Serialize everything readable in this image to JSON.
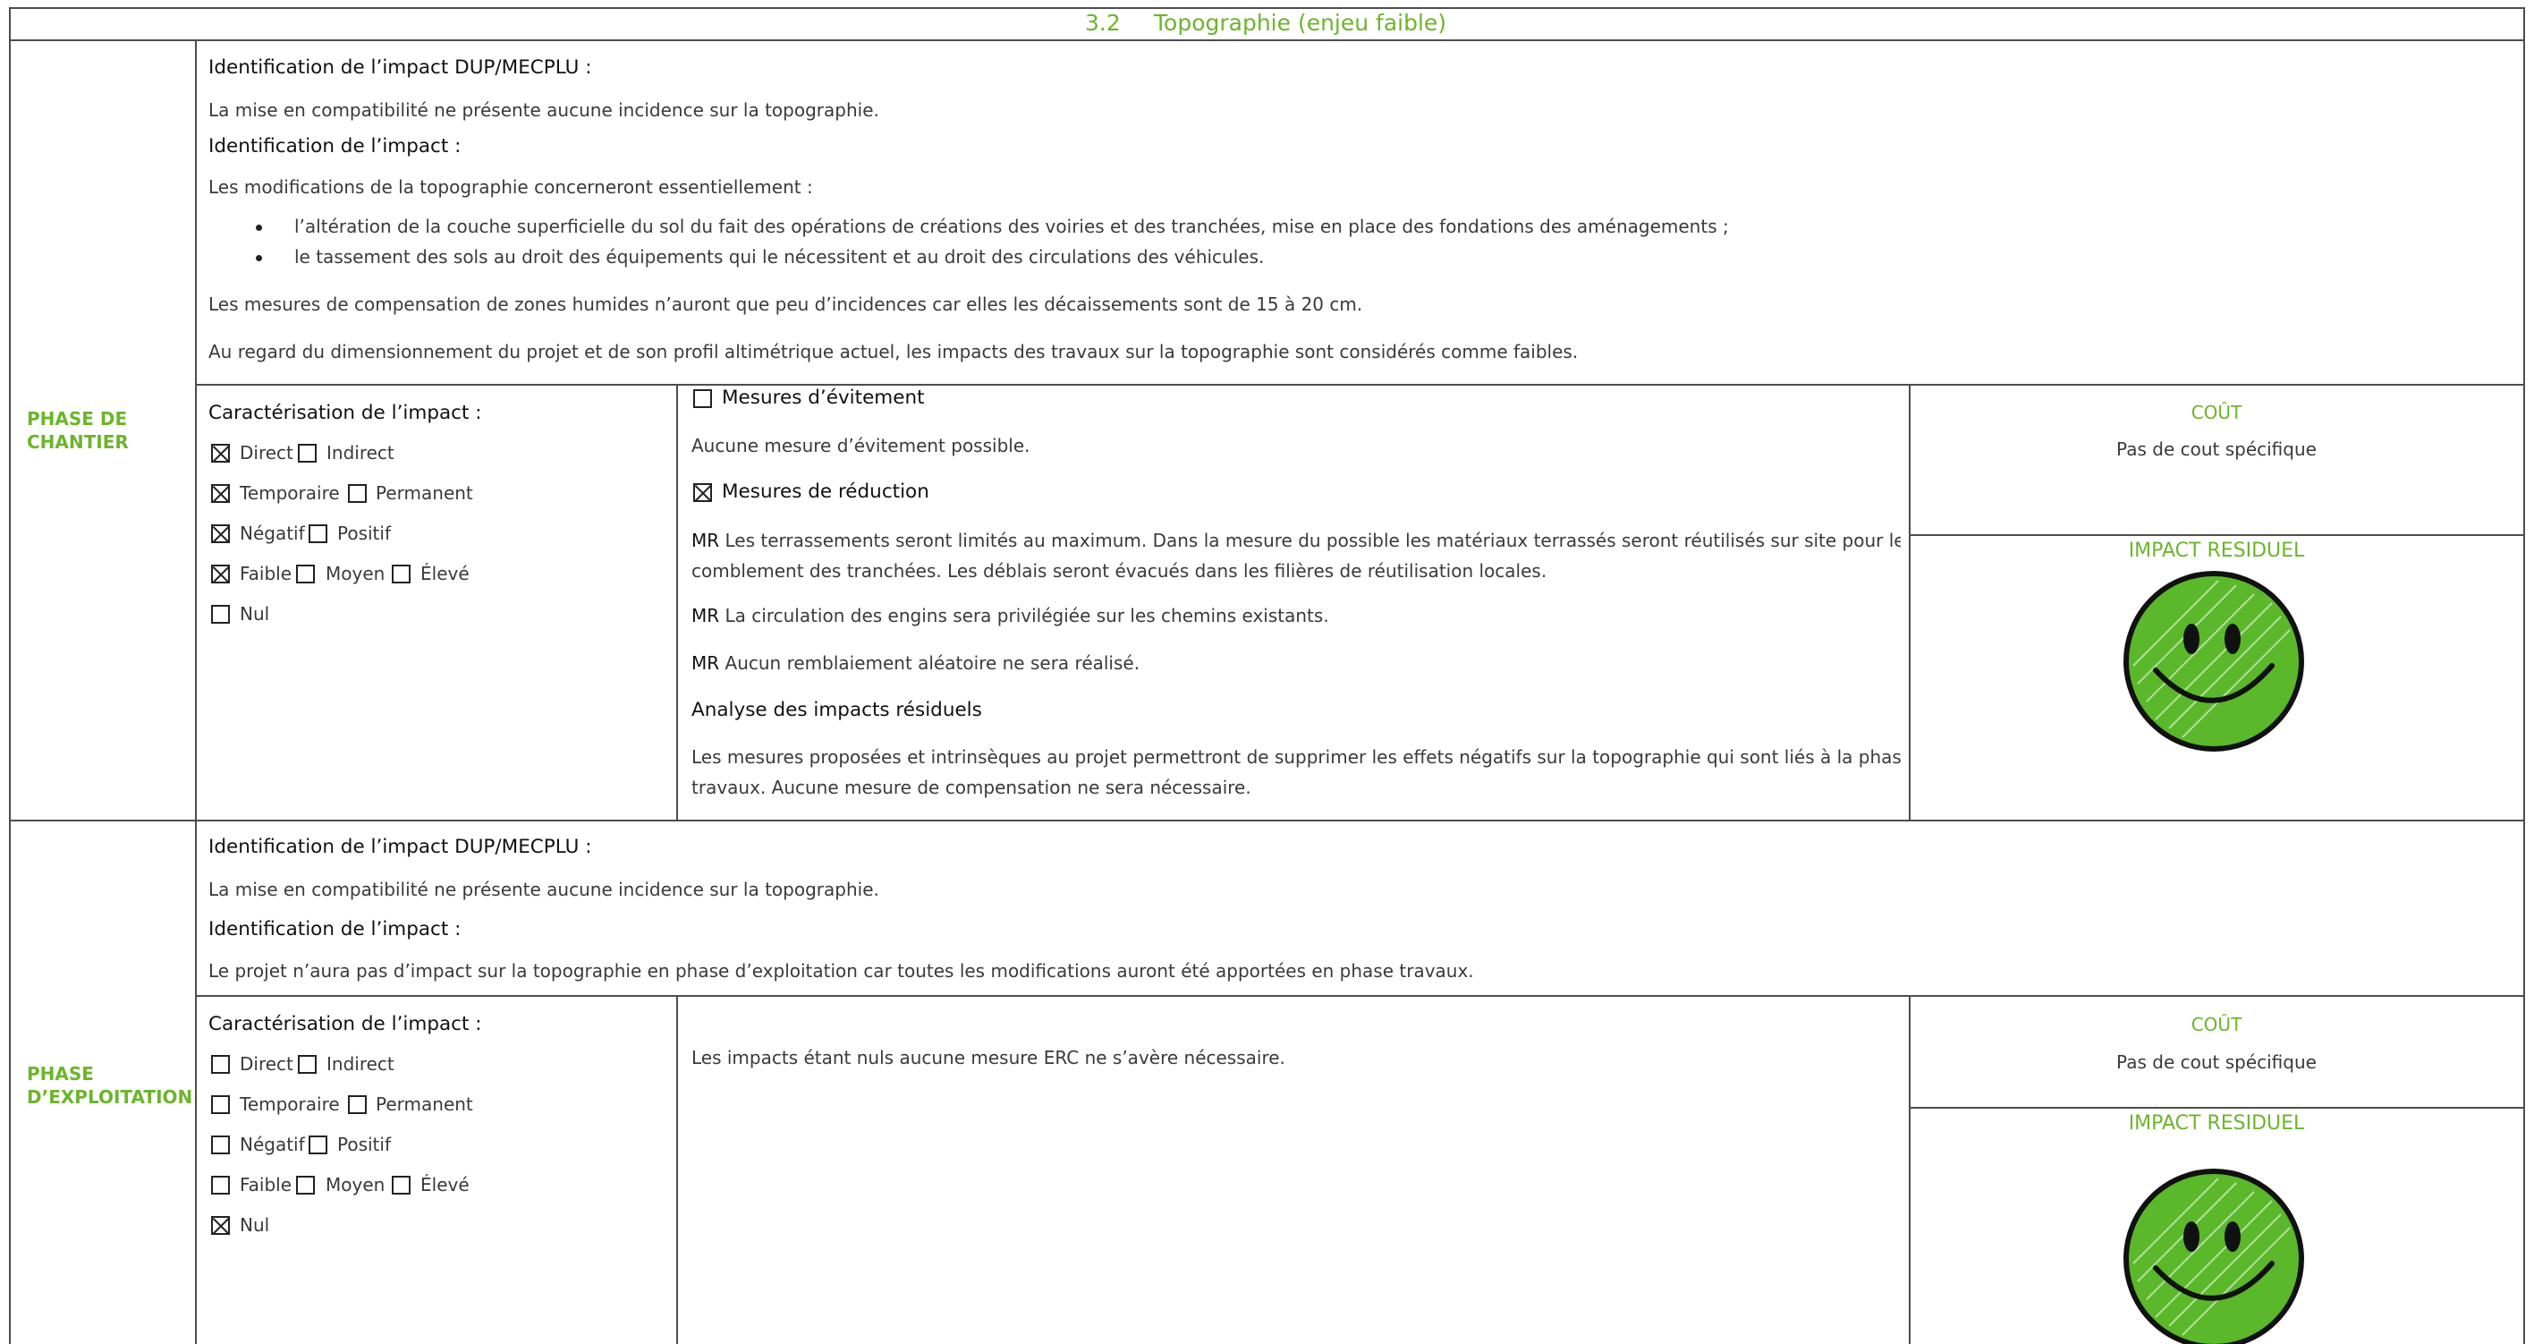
{
  "section": {
    "number": "3.2",
    "title": "Topographie (enjeu faible)"
  },
  "phase1": {
    "label_line1": "PHASE DE",
    "label_line2": "CHANTIER",
    "id_dup_heading": "Identification de l’impact DUP/MECPLU :",
    "id_dup_text": "La mise en compatibilité ne présente aucune incidence sur la topographie.",
    "id_heading": "Identification de l’impact :",
    "intro": "Les modifications de la topographie concerneront essentiellement :",
    "bullet1": "l’altération de la couche superficielle du sol du fait des opérations de créations des voiries et des tranchées, mise en place des fondations des aménagements ;",
    "bullet2": "le tassement des sols au droit des équipements qui le nécessitent et au droit des circulations des véhicules.",
    "para1": "Les mesures de compensation de zones humides n’auront que peu d’incidences car elles les décaissements sont de 15 à 20 cm.",
    "para2": "Au regard du dimensionnement du projet et de son profil altimétrique actuel, les impacts des travaux sur la topographie sont considérés comme faibles.",
    "carac_heading": "Caractérisation de l’impact :",
    "carac": {
      "direct": "Direct",
      "indirect": "Indirect",
      "temporaire": "Temporaire",
      "permanent": "Permanent",
      "negatif": "Négatif",
      "positif": "Positif",
      "faible": "Faible",
      "moyen": "Moyen",
      "eleve": "Élevé",
      "nul": "Nul"
    },
    "evitement_heading": "Mesures d’évitement",
    "evitement_text": "Aucune mesure d’évitement possible.",
    "reduction_heading": "Mesures de réduction",
    "mr_tag": "MR",
    "mr1_line1": "Les terrassements seront limités au maximum. Dans la mesure du possible les matériaux terrassés seront réutilisés sur site pour le",
    "mr1_line2": "comblement des tranchées. Les déblais seront évacués dans les filières de réutilisation locales.",
    "mr2": "La circulation des engins sera privilégiée sur les chemins existants.",
    "mr3": "Aucun remblaiement aléatoire ne sera réalisé.",
    "analyse_heading": "Analyse des impacts résiduels",
    "analyse_line1": "Les mesures proposées et intrinsèques au projet permettront de supprimer les effets négatifs sur la topographie qui sont liés à la phase",
    "analyse_line2": "travaux. Aucune mesure de compensation ne sera nécessaire.",
    "cout_heading": "COÛT",
    "cout_text": "Pas de cout spécifique",
    "residuel_heading": "IMPACT RESIDUEL"
  },
  "phase2": {
    "label_line1": "PHASE",
    "label_line2": "D’EXPLOITATION",
    "id_dup_heading": "Identification de l’impact DUP/MECPLU :",
    "id_dup_text": "La mise en compatibilité ne présente aucune incidence sur la topographie.",
    "id_heading": "Identification de l’impact :",
    "id_text": "Le projet n’aura pas d’impact sur la topographie en phase d’exploitation car toutes les modifications auront été apportées en phase travaux.",
    "carac_heading": "Caractérisation de l’impact :",
    "carac": {
      "direct": "Direct",
      "indirect": "Indirect",
      "temporaire": "Temporaire",
      "permanent": "Permanent",
      "negatif": "Négatif",
      "positif": "Positif",
      "faible": "Faible",
      "moyen": "Moyen",
      "eleve": "Élevé",
      "nul": "Nul"
    },
    "erc_text": "Les impacts étant nuls aucune mesure ERC ne s’avère nécessaire.",
    "cout_heading": "COÛT",
    "cout_text": "Pas de cout spécifique",
    "residuel_heading": "IMPACT RESIDUEL"
  },
  "colors": {
    "accent": "#6cb52b",
    "smiley_fill": "#5ab82a",
    "border": "#4d4d4d"
  },
  "icons": {
    "residual_impact": "smiley-face-icon"
  }
}
